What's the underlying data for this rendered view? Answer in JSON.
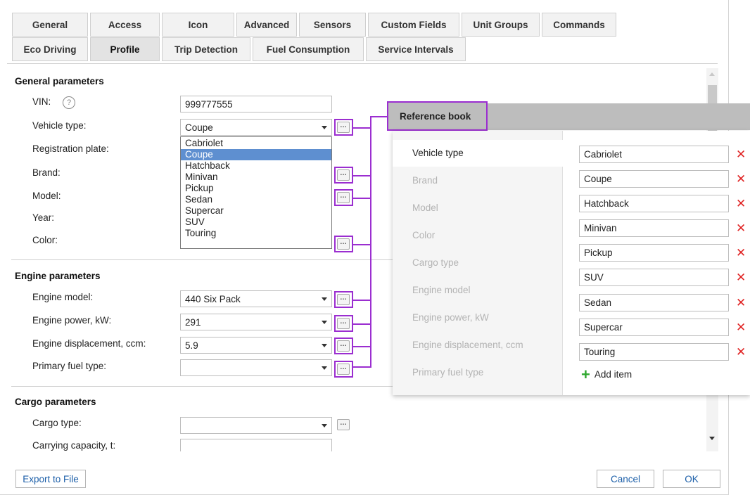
{
  "tabs": {
    "row1": [
      "General",
      "Access",
      "Icon",
      "Advanced",
      "Sensors",
      "Custom Fields",
      "Unit Groups",
      "Commands"
    ],
    "row2": [
      "Eco Driving",
      "Profile",
      "Trip Detection",
      "Fuel Consumption",
      "Service Intervals"
    ],
    "active": "Profile"
  },
  "general": {
    "title": "General parameters",
    "vin_label": "VIN:",
    "vin_value": "999777555",
    "vehicle_type_label": "Vehicle type:",
    "vehicle_type_value": "Coupe",
    "registration_label": "Registration plate:",
    "brand_label": "Brand:",
    "model_label": "Model:",
    "year_label": "Year:",
    "color_label": "Color:",
    "help_glyph": "?"
  },
  "vehicle_type_options": [
    "Cabriolet",
    "Coupe",
    "Hatchback",
    "Minivan",
    "Pickup",
    "Sedan",
    "Supercar",
    "SUV",
    "Touring"
  ],
  "engine": {
    "title": "Engine parameters",
    "model_label": "Engine model:",
    "model_value": "440 Six Pack",
    "power_label": "Engine power, kW:",
    "power_value": "291",
    "displacement_label": "Engine displacement, ccm:",
    "displacement_value": "5.9",
    "fuel_label": "Primary fuel type:",
    "fuel_value": ""
  },
  "cargo": {
    "title": "Cargo parameters",
    "type_label": "Cargo type:",
    "type_value": "",
    "capacity_label": "Carrying capacity, t:",
    "capacity_value": ""
  },
  "footer": {
    "export_label": "Export to File",
    "cancel_label": "Cancel",
    "ok_label": "OK"
  },
  "reference_book": {
    "title": "Reference book",
    "categories": [
      "Vehicle type",
      "Brand",
      "Model",
      "Color",
      "Cargo type",
      "Engine model",
      "Engine power, kW",
      "Engine displacement, ccm",
      "Primary fuel type"
    ],
    "active_category": "Vehicle type",
    "items": [
      "Cabriolet",
      "Coupe",
      "Hatchback",
      "Minivan",
      "Pickup",
      "SUV",
      "Sedan",
      "Supercar",
      "Touring"
    ],
    "add_label": "Add item",
    "delete_glyph": "✕"
  },
  "colors": {
    "highlight": "#9b2ed0",
    "selection": "#5e8fd0",
    "delete": "#e02424",
    "add": "#2fa82f"
  },
  "icons": {
    "ellipsis": "…",
    "plus": "+"
  }
}
